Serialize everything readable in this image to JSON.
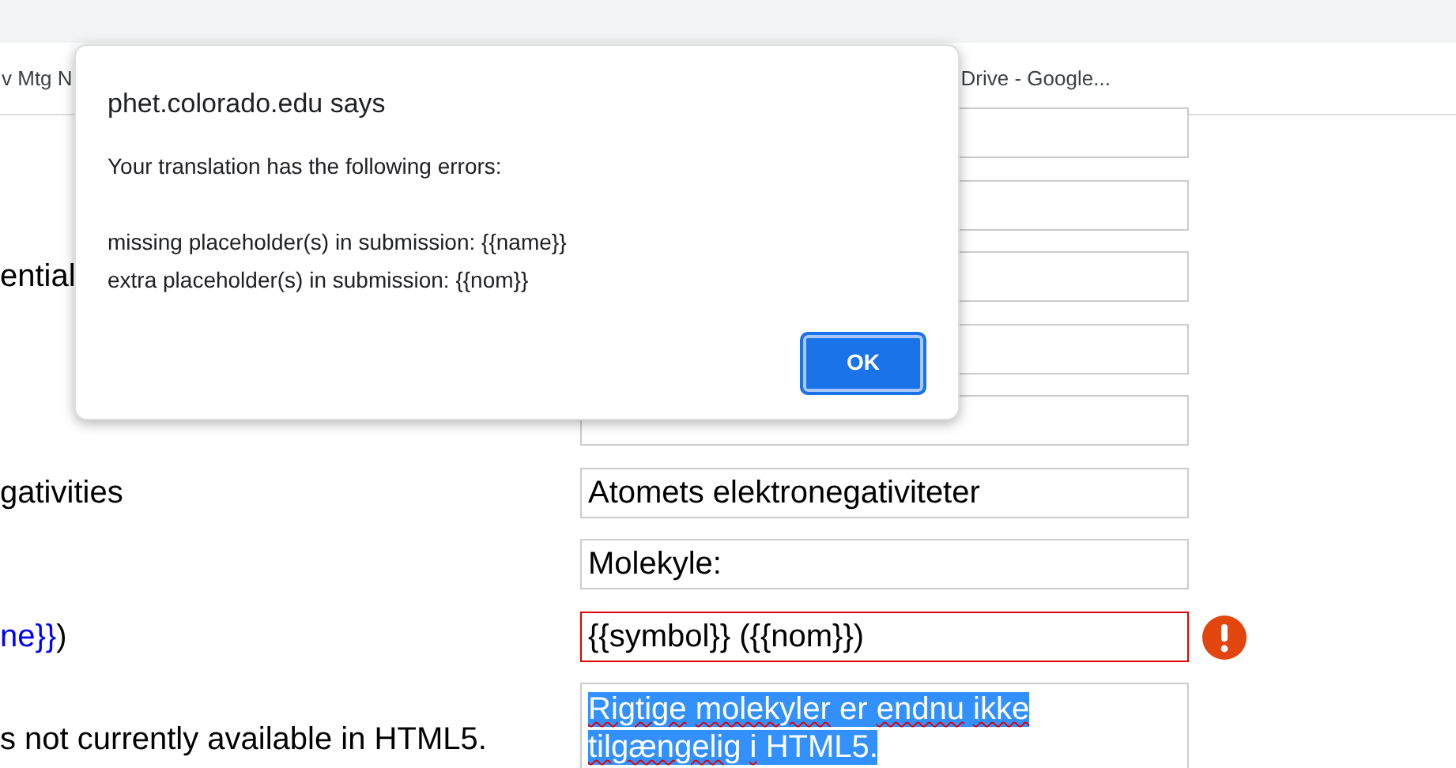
{
  "bookmarks": [
    {
      "label": "v Mtg N"
    },
    {
      "label": "Drive - Google..."
    }
  ],
  "rows": [
    {
      "label": [],
      "value": ""
    },
    {
      "label": [],
      "value": ""
    },
    {
      "label": [
        {
          "kind": "plain",
          "text": "ential"
        }
      ],
      "value": ""
    },
    {
      "label": [],
      "value": ""
    },
    {
      "label": [],
      "value": ""
    },
    {
      "label": [
        {
          "kind": "plain",
          "text": "gativities"
        }
      ],
      "value": "Atomets elektronegativiteter"
    },
    {
      "label": [],
      "value": "Molekyle:"
    },
    {
      "label": [
        {
          "kind": "placeholder",
          "text": "ne}}"
        },
        {
          "kind": "plain",
          "text": ")"
        }
      ],
      "value": "{{symbol}} ({{nom}})",
      "error": true
    },
    {
      "label": [
        {
          "kind": "plain",
          "text": "s not currently available in HTML5."
        }
      ],
      "kind": "textarea",
      "selected": true,
      "words": [
        {
          "text": "Rigtige",
          "misspelled": true
        },
        {
          "text": "molekyler",
          "misspelled": true
        },
        {
          "text": "er",
          "misspelled": false
        },
        {
          "text": "endnu",
          "misspelled": true
        },
        {
          "text": "ikke",
          "misspelled": true
        },
        {
          "text": "tilgængelig",
          "misspelled": true
        },
        {
          "text": "i",
          "misspelled": true
        },
        {
          "text": "HTML5.",
          "misspelled": false
        }
      ]
    }
  ],
  "dialog": {
    "title": "phet.colorado.edu says",
    "lines": [
      "Your translation has the following errors:",
      "missing placeholder(s) in submission: {{name}}",
      "extra placeholder(s) in submission: {{nom}}"
    ],
    "button": "OK"
  }
}
